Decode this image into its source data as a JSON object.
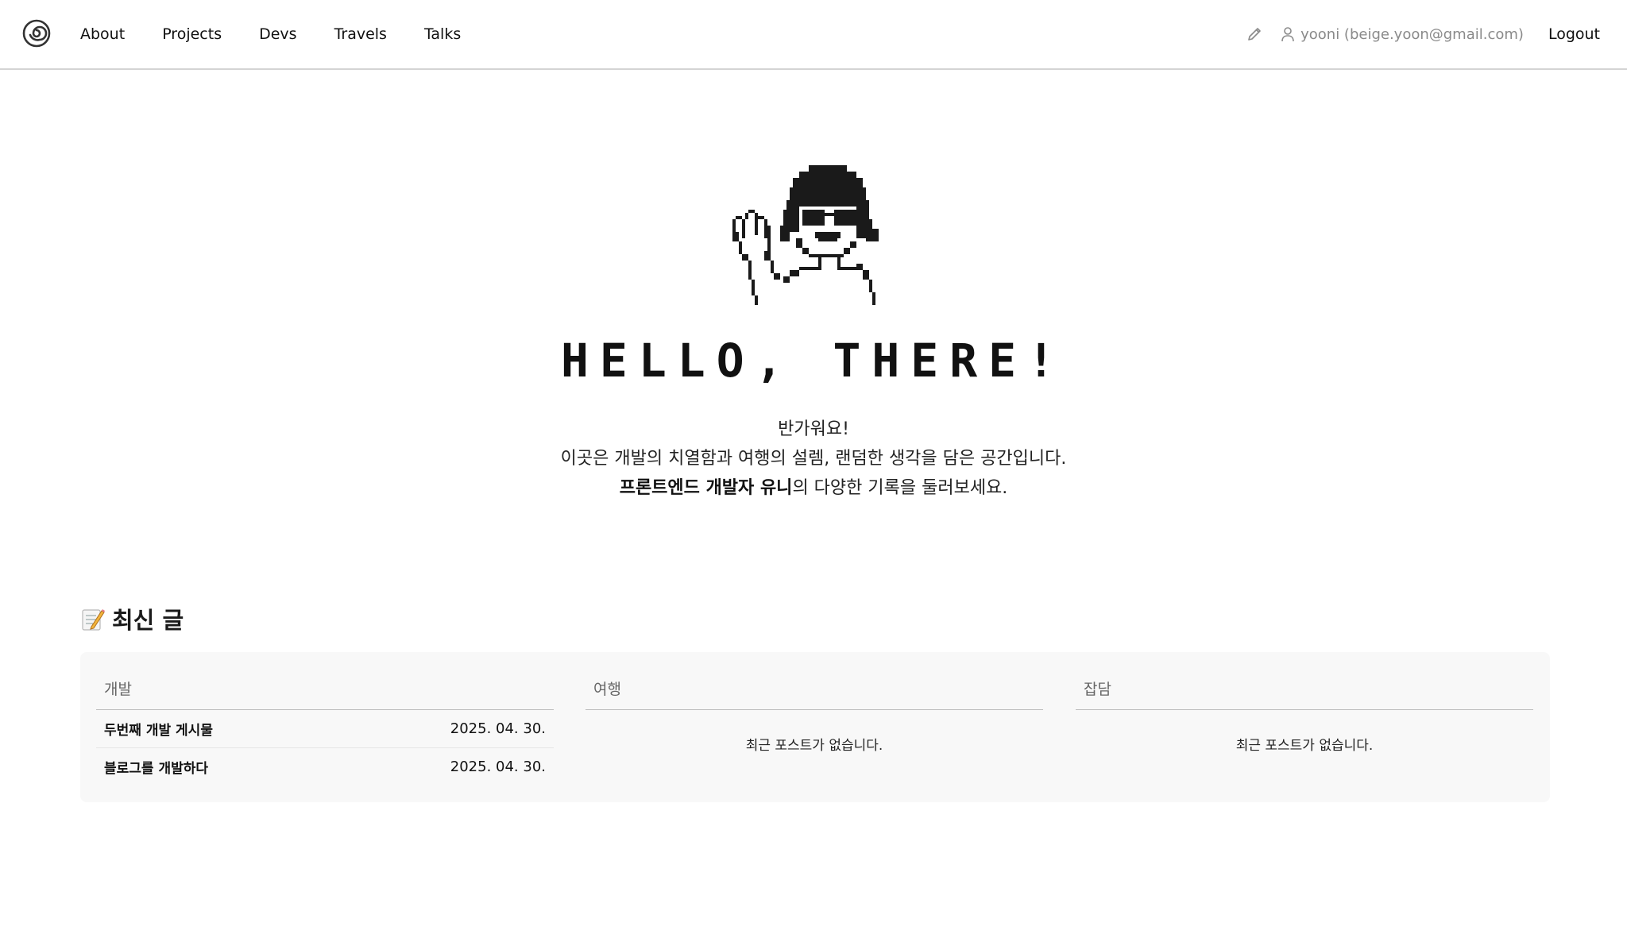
{
  "header": {
    "logo_icon": "spiral-logo-icon",
    "nav": [
      {
        "label": "About"
      },
      {
        "label": "Projects"
      },
      {
        "label": "Devs"
      },
      {
        "label": "Travels"
      },
      {
        "label": "Talks"
      }
    ],
    "edit_icon": "pencil-icon",
    "user_icon": "user-icon",
    "user_label": "yooni (beige.yoon@gmail.com)",
    "logout_label": "Logout"
  },
  "hero": {
    "avatar_icon": "pixel-avatar-waving-icon",
    "title": "HELLO, THERE!",
    "intro_line1": "반가워요!",
    "intro_line2": "이곳은 개발의 치열함과 여행의 설렘, 랜덤한 생각을 담은 공간입니다.",
    "intro_line3_bold": "프론트엔드 개발자 유니",
    "intro_line3_rest": "의 다양한 기록을 둘러보세요."
  },
  "recent": {
    "emoji_icon": "memo-icon",
    "title": "최신 글",
    "columns": [
      {
        "title": "개발",
        "posts": [
          {
            "title": "두번째 개발 게시물",
            "date": "2025. 04. 30."
          },
          {
            "title": "블로그를 개발하다",
            "date": "2025. 04. 30."
          }
        ]
      },
      {
        "title": "여행",
        "empty_text": "최근 포스트가 없습니다."
      },
      {
        "title": "잡담",
        "empty_text": "최근 포스트가 없습니다."
      }
    ]
  }
}
